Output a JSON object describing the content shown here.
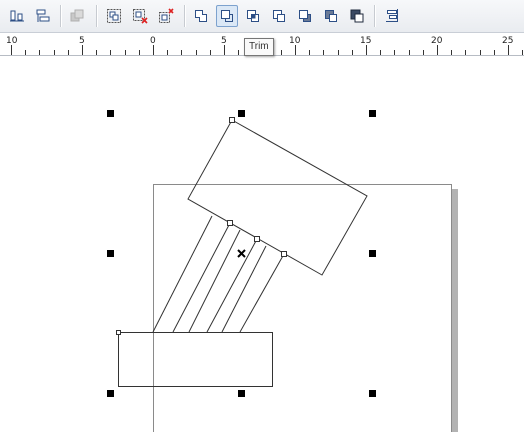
{
  "toolbar": {
    "buttons": [
      {
        "name": "align-distribute-icon"
      },
      {
        "name": "order-layers-icon"
      },
      {
        "name": "combine-disabled-icon"
      },
      {
        "name": "group-icon"
      },
      {
        "name": "ungroup-icon"
      },
      {
        "name": "ungroup-all-icon"
      },
      {
        "name": "weld-icon"
      },
      {
        "name": "trim-icon",
        "active": true
      },
      {
        "name": "intersect-icon"
      },
      {
        "name": "simplify-icon"
      },
      {
        "name": "front-minus-back-icon"
      },
      {
        "name": "back-minus-front-icon"
      },
      {
        "name": "create-boundary-icon"
      },
      {
        "name": "align-options-icon"
      }
    ]
  },
  "tooltip": {
    "text": "Trim"
  },
  "ruler": {
    "unit_labels": [
      "10",
      "5",
      "0",
      "5",
      "10",
      "15",
      "20",
      "25"
    ]
  },
  "colors": {
    "toolbar_bg": "#eef0f3",
    "active_button": "#dbe8f6",
    "page_shadow": "#b3b3b3",
    "shape_stroke": "#333333",
    "handle": "#000000"
  }
}
